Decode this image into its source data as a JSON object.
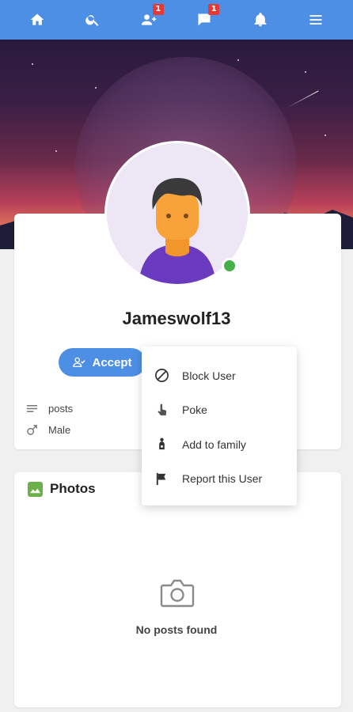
{
  "nav": {
    "items": [
      {
        "icon": "home-icon"
      },
      {
        "icon": "search-icon"
      },
      {
        "icon": "friend-requests-icon",
        "badge": "1"
      },
      {
        "icon": "messages-icon",
        "badge": "1"
      },
      {
        "icon": "notifications-icon"
      },
      {
        "icon": "menu-icon"
      }
    ],
    "color": "#4e8fe6"
  },
  "profile": {
    "username": "Jameswolf13",
    "online": true,
    "accept_label": "Accept",
    "info": {
      "posts_label": "posts",
      "gender": "Male"
    }
  },
  "dropdown": {
    "items": [
      {
        "label": "Block User",
        "icon": "block-icon"
      },
      {
        "label": "Poke",
        "icon": "poke-hand-icon"
      },
      {
        "label": "Add to family",
        "icon": "family-icon"
      },
      {
        "label": "Report this User",
        "icon": "flag-icon"
      }
    ]
  },
  "photos": {
    "title": "Photos",
    "empty_text": "No posts found"
  },
  "colors": {
    "accent": "#4e8fe6",
    "online": "#43b04a",
    "badge": "#e53935",
    "photos_icon": "#6bb04a"
  }
}
